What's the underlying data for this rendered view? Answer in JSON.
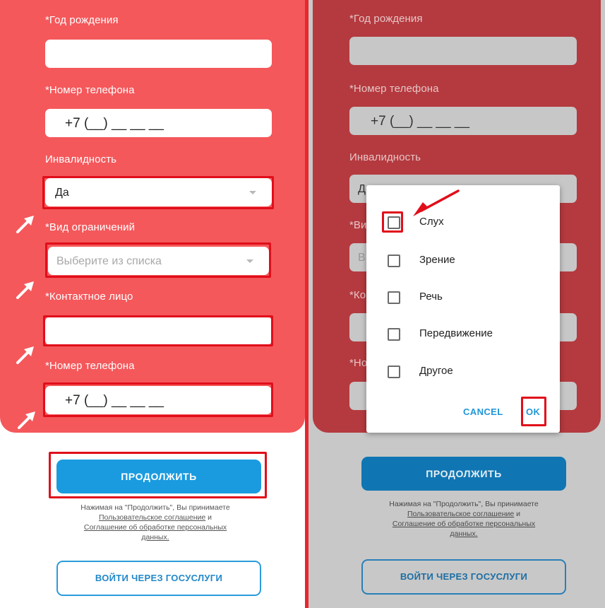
{
  "form": {
    "birth_year_label": "*Год рождения",
    "birth_year_value": "",
    "phone_label": "*Номер телефона",
    "phone_value": "+7 (__) __ __ __",
    "disability_label": "Инвалидность",
    "disability_value": "Да",
    "limitation_label": "*Вид ограничений",
    "limitation_placeholder": "Выберите из списка",
    "contact_label": "*Контактное лицо",
    "contact_value": "",
    "contact_phone_label": "*Номер телефона",
    "contact_phone_value": "+7 (__) __ __ __"
  },
  "right_form": {
    "birth_year_label": "*Год рождения",
    "phone_label": "*Номер телефона",
    "phone_value": "+7 (__) __ __ __",
    "disability_label": "Инвалидность",
    "disability_value_fragment": "Д",
    "limitation_label_fragment": "*Ви",
    "limitation_placeholder_fragment": "В",
    "contact_label_fragment": "*Ко",
    "contact_phone_label_fragment": "*Но"
  },
  "actions": {
    "continue_label": "ПРОДОЛЖИТЬ",
    "terms_prefix": "Нажимая на \"Продолжить\", Вы принимаете",
    "terms_link1": "Пользовательское соглашение",
    "terms_and": "и",
    "terms_link2a": "Соглашение об обработке персональных",
    "terms_link2b": "данных.",
    "gosuslugi_label": "ВОЙТИ ЧЕРЕЗ ГОСУСЛУГИ"
  },
  "dialog": {
    "options": [
      {
        "label": "Слух",
        "checked": false
      },
      {
        "label": "Зрение",
        "checked": false
      },
      {
        "label": "Речь",
        "checked": false
      },
      {
        "label": "Передвижение",
        "checked": false
      },
      {
        "label": "Другое",
        "checked": false
      }
    ],
    "cancel_label": "CANCEL",
    "ok_label": "OK"
  },
  "colors": {
    "card_left": "#f4585b",
    "card_right": "#b43a3f",
    "highlight": "#e10e1a",
    "primary_button": "#1a9be0",
    "primary_button_dim": "#1076b3"
  },
  "icons": [
    "annotation-arrow-icon",
    "checkbox-icon",
    "chevron-down-icon"
  ]
}
